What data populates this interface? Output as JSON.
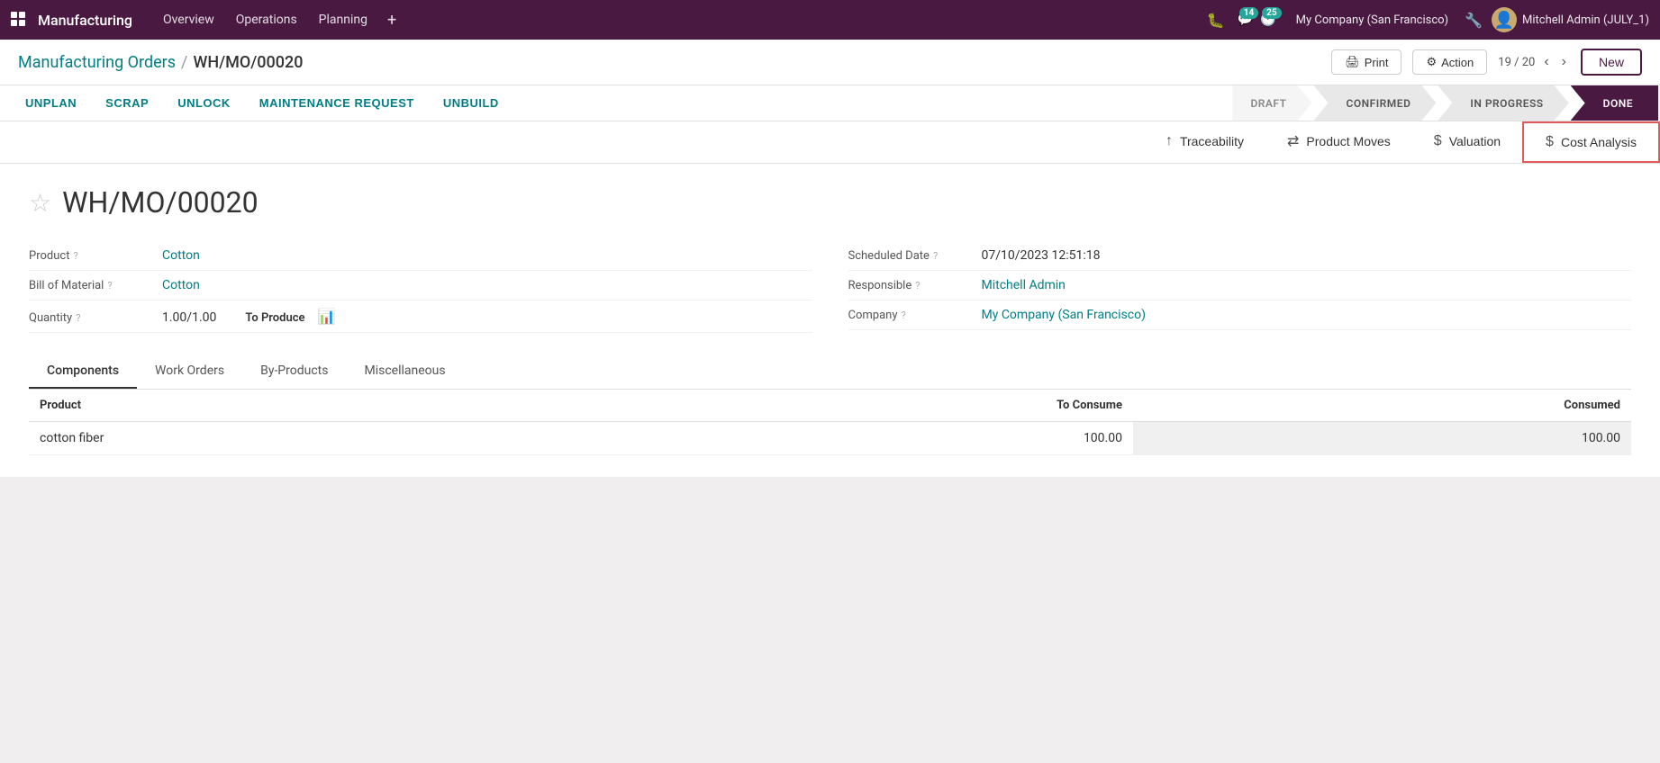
{
  "app": {
    "name": "Manufacturing",
    "grid_icon": "⊞"
  },
  "nav": {
    "items": [
      {
        "label": "Overview",
        "id": "overview"
      },
      {
        "label": "Operations",
        "id": "operations"
      },
      {
        "label": "Planning",
        "id": "planning"
      }
    ],
    "plus": "+",
    "bug_icon": "🐛",
    "chat_badge": "14",
    "activity_badge": "25",
    "company": "My Company (San Francisco)",
    "user": "Mitchell Admin (JULY_1)"
  },
  "breadcrumb": {
    "parent": "Manufacturing Orders",
    "separator": "/",
    "current": "WH/MO/00020"
  },
  "toolbar": {
    "print_label": "Print",
    "action_label": "Action",
    "page_info": "19 / 20",
    "new_label": "New"
  },
  "action_buttons": [
    {
      "label": "UNPLAN",
      "id": "unplan"
    },
    {
      "label": "SCRAP",
      "id": "scrap"
    },
    {
      "label": "UNLOCK",
      "id": "unlock"
    },
    {
      "label": "MAINTENANCE REQUEST",
      "id": "maintenance"
    },
    {
      "label": "UNBUILD",
      "id": "unbuild"
    }
  ],
  "status_steps": [
    {
      "label": "DRAFT",
      "state": "draft"
    },
    {
      "label": "CONFIRMED",
      "state": "confirmed"
    },
    {
      "label": "IN PROGRESS",
      "state": "in_progress"
    },
    {
      "label": "DONE",
      "state": "done",
      "active": true
    }
  ],
  "top_tabs": [
    {
      "label": "Traceability",
      "icon": "↑",
      "id": "traceability"
    },
    {
      "label": "Product Moves",
      "icon": "⇄",
      "id": "product_moves"
    },
    {
      "label": "Valuation",
      "icon": "$",
      "id": "valuation"
    },
    {
      "label": "Cost Analysis",
      "icon": "$",
      "id": "cost_analysis",
      "active": true
    }
  ],
  "record": {
    "title": "WH/MO/00020",
    "star": "☆"
  },
  "form": {
    "left": [
      {
        "label": "Product",
        "help": true,
        "value": "Cotton",
        "is_link": true
      },
      {
        "label": "Bill of Material",
        "help": true,
        "value": "Cotton",
        "is_link": true
      },
      {
        "label": "Quantity",
        "help": true,
        "value": "1.00/1.00",
        "is_link": false,
        "extra": "To Produce",
        "has_chart": true
      }
    ],
    "right": [
      {
        "label": "Scheduled Date",
        "help": true,
        "value": "07/10/2023 12:51:18",
        "is_link": false
      },
      {
        "label": "Responsible",
        "help": true,
        "value": "Mitchell Admin",
        "is_link": true
      },
      {
        "label": "Company",
        "help": true,
        "value": "My Company (San Francisco)",
        "is_link": true
      }
    ]
  },
  "inner_tabs": [
    {
      "label": "Components",
      "active": true
    },
    {
      "label": "Work Orders"
    },
    {
      "label": "By-Products"
    },
    {
      "label": "Miscellaneous"
    }
  ],
  "table": {
    "headers": [
      {
        "label": "Product",
        "align": "left"
      },
      {
        "label": "To Consume",
        "align": "right"
      },
      {
        "label": "Consumed",
        "align": "right"
      }
    ],
    "rows": [
      {
        "product": "cotton fiber",
        "to_consume": "100.00",
        "consumed": "100.00"
      }
    ]
  }
}
